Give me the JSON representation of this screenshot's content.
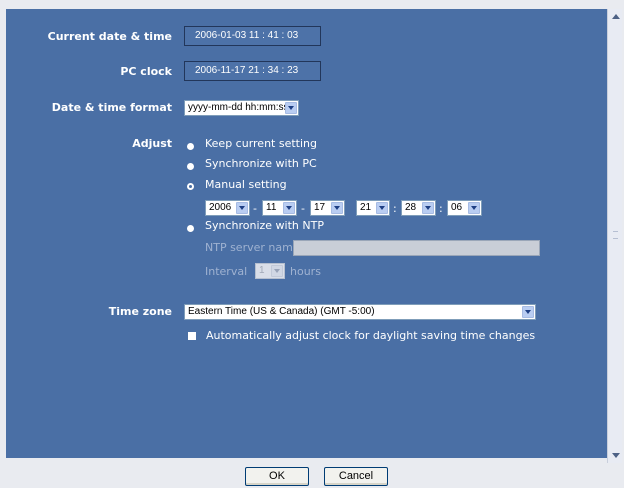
{
  "labels": {
    "current_datetime": "Current date & time",
    "pc_clock": "PC clock",
    "format": "Date & time format",
    "adjust": "Adjust",
    "time_zone": "Time zone"
  },
  "values": {
    "current_datetime": "2006-01-03 11 : 41 : 03",
    "pc_clock": "2006-11-17 21 : 34 : 23",
    "format": "yyyy-mm-dd hh:mm:ss"
  },
  "adjust": {
    "options": [
      "Keep current setting",
      "Synchronize with PC",
      "Manual setting",
      "Synchronize with NTP"
    ],
    "selected": "Manual setting",
    "manual": {
      "year": "2006",
      "month": "11",
      "day": "17",
      "hour": "21",
      "minute": "28",
      "second": "06",
      "date_sep": "-",
      "time_sep": ":"
    },
    "ntp_server_label": "NTP server name",
    "ntp_server_value": "",
    "interval_label": "Interval",
    "interval_value": "1",
    "interval_unit": "hours"
  },
  "timezone": {
    "value": "Eastern Time (US & Canada) (GMT -5:00)",
    "dst_label": "Automatically adjust clock for daylight saving time changes"
  },
  "buttons": {
    "ok": "OK",
    "cancel": "Cancel"
  },
  "colors": {
    "panel_bg": "#4a6fa5",
    "page_bg": "#e9ebf0",
    "text": "#ffffff"
  }
}
